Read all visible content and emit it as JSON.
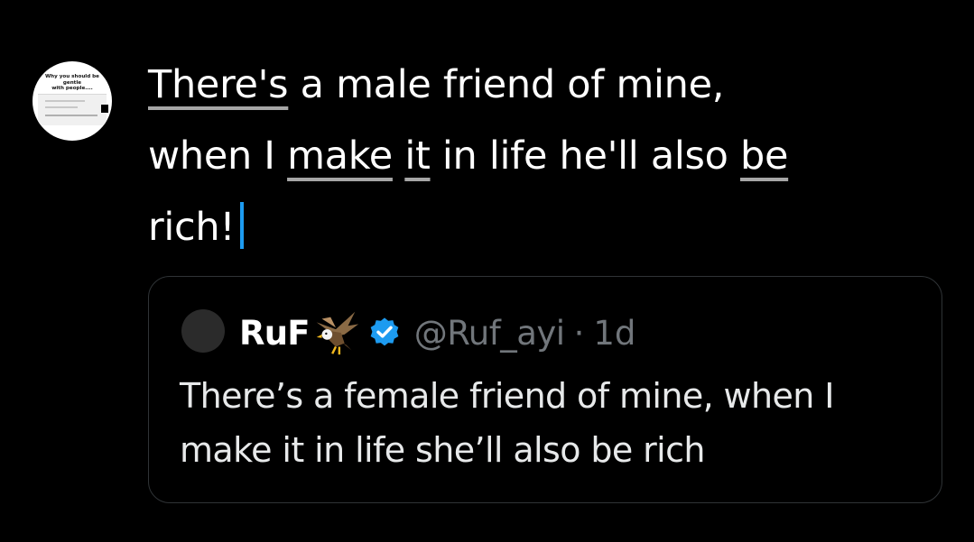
{
  "avatar": {
    "caption_line1": "Why you should be gentle",
    "caption_line2": "with people...."
  },
  "composer": {
    "line1": {
      "w1": "There's",
      "rest": " a male friend of mine,"
    },
    "line2": {
      "p1": "when I ",
      "w_make": "make",
      "sp": " ",
      "w_it": "it",
      "p2": " in life he'll also ",
      "w_be": "be"
    },
    "line3": {
      "text": "rich!"
    }
  },
  "quote": {
    "name": "RuF",
    "emoji_icon": "eagle-icon",
    "verified_icon": "verified-badge-icon",
    "handle": "@Ruf_ayi",
    "separator": "·",
    "time": "1d",
    "body_line1": "There’s a female friend of mine, when I",
    "body_line2": "make it in life she’ll also be rich"
  },
  "colors": {
    "background": "#000000",
    "text": "#ffffff",
    "secondary": "#71767b",
    "accent": "#1d9bf0",
    "border": "#2f3336",
    "spellcheck_underline": "#a6a6a6"
  }
}
